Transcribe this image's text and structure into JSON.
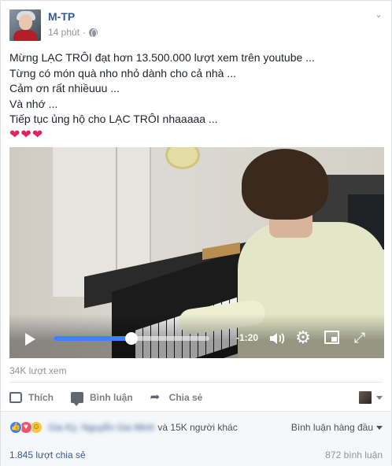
{
  "post": {
    "author": "M-TP",
    "time": "14 phút",
    "privacy_icon": "globe-icon",
    "lines": [
      "Mừng LẠC TRÔI đạt hơn 13.500.000 lượt xem trên youtube ...",
      "Từng có món quà nho nhỏ dành cho cả nhà ...",
      "Cảm ơn rất nhiềuuu ...",
      "Và nhớ ...",
      "Tiếp tục ủng hộ cho LẠC TRÔI nhaaaaa ..."
    ],
    "hearts": "❤❤❤"
  },
  "video": {
    "time_remaining": "-1:20",
    "progress": 0.5,
    "accent": "#4080ff"
  },
  "stats": {
    "views": "34K lượt xem"
  },
  "actions": {
    "like": "Thích",
    "comment": "Bình luận",
    "share": "Chia sẻ"
  },
  "reactions": {
    "names": "Gia Kỳ, Nguyễn Gia Minh",
    "others": "và 15K người khác",
    "sort": "Bình luận hàng đầu",
    "shares": "1.845 lượt chia sẻ",
    "comments": "872 bình luận"
  },
  "colors": {
    "link": "#365899",
    "muted": "#90949c",
    "heart": "#e0245e"
  }
}
